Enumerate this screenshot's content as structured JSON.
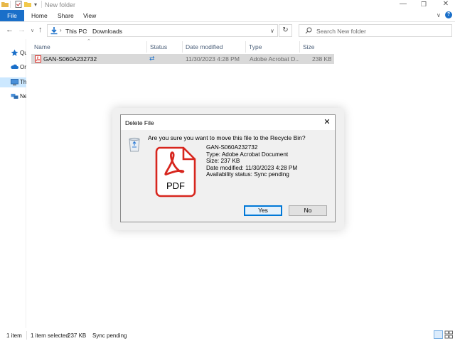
{
  "window": {
    "title": "New folder",
    "quick_access_icons": [
      "folder-icon",
      "properties-check-icon",
      "new-folder-icon",
      "customize-arrow-icon"
    ],
    "controls": [
      "minimize-icon",
      "maximize-icon",
      "close-icon"
    ]
  },
  "ribbon": {
    "tabs": [
      "File",
      "Home",
      "Share",
      "View"
    ],
    "accent": "#1a6fc9"
  },
  "address": {
    "path": [
      "This PC",
      "Downloads"
    ],
    "search_placeholder": "Search New folder"
  },
  "nav_pane": {
    "items": [
      {
        "label": "Quick access",
        "icon": "star-icon"
      },
      {
        "label": "OneDrive",
        "icon": "cloud-icon"
      },
      {
        "label": "This PC",
        "icon": "computer-icon"
      },
      {
        "label": "Network",
        "icon": "network-icon"
      }
    ],
    "selected_index": 2
  },
  "file_list": {
    "columns": [
      "Name",
      "Status",
      "Date modified",
      "Type",
      "Size"
    ],
    "rows": [
      {
        "name": "GAN-S060A232732",
        "status_icon": "sync-pending-icon",
        "date_modified": "11/30/2023 4:28 PM",
        "type": "Adobe Acrobat D...",
        "size": "238 KB"
      }
    ]
  },
  "status_bar": {
    "item_count": "1 item",
    "selection": "1 item selected",
    "selection_size": "237 KB",
    "sync": "Sync pending"
  },
  "dialog": {
    "title": "Delete File",
    "question": "Are you sure you want to move this file to the Recycle Bin?",
    "file_icon_label": "PDF",
    "details": [
      "GAN-S060A232732",
      "Type: Adobe Acrobat Document",
      "Size: 237 KB",
      "Date modified: 11/30/2023 4:28 PM",
      "Availability status: Sync pending"
    ],
    "yes_label": "Yes",
    "no_label": "No",
    "pdf_color": "#d7261e"
  }
}
